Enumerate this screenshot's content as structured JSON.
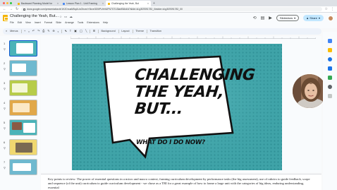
{
  "browser": {
    "tabs": [
      {
        "title": "Backward Planning Model for",
        "active": false,
        "favicon_color": "#f4b400"
      },
      {
        "title": "Lesson Plan 1 - Unit Framing",
        "active": false,
        "favicon_color": "#4285f4"
      },
      {
        "title": "Challenging the Yeah, But",
        "active": true,
        "favicon_color": "#f4b400"
      }
    ],
    "new_tab": "+",
    "url": "docs.google.com/presentation/d/1K2DnusM5qUUuGhcezY4kxe3D5IPUhHAPN7G7U3laeB4bd/d?slide=id.g3f2f391782_0#slide=id.g3f2f391782_00"
  },
  "doc": {
    "title": "Challenging the Yeah, But...",
    "menu": [
      "File",
      "Edit",
      "View",
      "Insert",
      "Format",
      "Slide",
      "Arrange",
      "Tools",
      "Extensions",
      "Help"
    ],
    "slideshow_label": "Slideshow",
    "share_label": "Share"
  },
  "toolbar": {
    "menus_label": "Menus",
    "background_label": "Background",
    "layout_label": "Layout",
    "theme_label": "Theme",
    "transition_label": "Transition"
  },
  "filmstrip": {
    "slides": [
      {
        "number": "1",
        "bg": "#4bb3b8",
        "selected": true
      },
      {
        "number": "2",
        "bg": "#6fb9cf",
        "selected": false
      },
      {
        "number": "3",
        "bg": "#b7cc4a",
        "selected": false
      },
      {
        "number": "4",
        "bg": "#e1a84a",
        "selected": false
      },
      {
        "number": "5",
        "bg": "#4bb3b8",
        "selected": false
      },
      {
        "number": "6",
        "bg": "#f0d870",
        "selected": false
      },
      {
        "number": "7",
        "bg": "#6fb9cf",
        "selected": false
      }
    ]
  },
  "slide": {
    "line1": "CHALLENGING",
    "line2": "THE YEAH,",
    "line3": "BUT...",
    "subtitle": "WHAT DO I DO NOW?",
    "background": "#3fa3a8"
  },
  "notes": {
    "text": "Key points to review: The power of essential questions in a micro and macro context, framing curriculum development by performance tasks (the big assessment), use of rubrics to guide feedback, scope and sequence (of the unit) curriculum to guide curriculum development - we chose as a TRI for a great example of how to frame a large unit with the categories of big ideas, enduring understanding, essential"
  }
}
